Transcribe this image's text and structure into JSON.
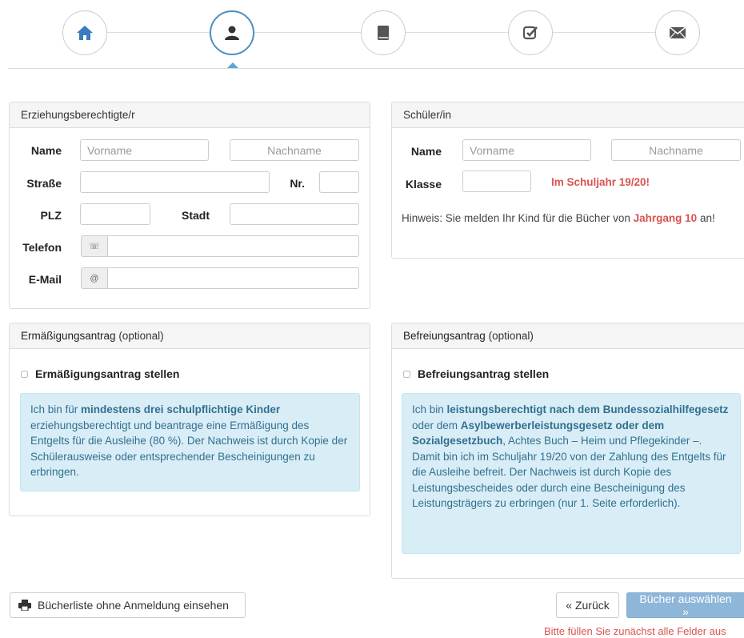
{
  "colors": {
    "accent": "#4a90c2",
    "danger": "#d9534f",
    "info_bg": "#d9edf7",
    "info_text": "#31708f",
    "primary_disabled": "#8eb6d9"
  },
  "wizard": {
    "steps": [
      {
        "icon": "home-icon"
      },
      {
        "icon": "user-icon",
        "active": true
      },
      {
        "icon": "book-icon"
      },
      {
        "icon": "check-square-icon"
      },
      {
        "icon": "envelope-icon"
      }
    ]
  },
  "guardian": {
    "title": "Erziehungsberechtigte/r",
    "name_label": "Name",
    "firstname_placeholder": "Vorname",
    "lastname_placeholder": "Nachname",
    "street_label": "Straße",
    "nr_label": "Nr.",
    "zip_label": "PLZ",
    "city_label": "Stadt",
    "phone_label": "Telefon",
    "phone_addon": "☏",
    "email_label": "E-Mail",
    "email_addon": "@"
  },
  "student": {
    "title": "Schüler/in",
    "name_label": "Name",
    "firstname_placeholder": "Vorname",
    "lastname_placeholder": "Nachname",
    "class_label": "Klasse",
    "year_note": "Im Schuljahr 19/20!",
    "hint_prefix": "Hinweis: Sie melden Ihr Kind für die Bücher von ",
    "hint_grade": "Jahrgang 10",
    "hint_suffix": " an!"
  },
  "reduction": {
    "title": "Ermäßigungsantrag",
    "optional": " (optional)",
    "checkbox_label": "Ermäßigungsantrag stellen",
    "info": {
      "p1": "Ich bin für ",
      "b1": "mindestens drei schulpflichtige Kinder",
      "p2": " erziehungsberechtigt und beantrage eine Ermäßigung des Entgelts für die Ausleihe (80 %). Der Nachweis ist durch Kopie der Schülerausweise oder entsprechender Bescheinigungen zu erbringen."
    }
  },
  "exemption": {
    "title": "Befreiungsantrag",
    "optional": " (optional)",
    "checkbox_label": "Befreiungsantrag stellen",
    "info": {
      "p1": "Ich bin ",
      "b1": "leistungsberechtigt nach dem Bundessozialhilfegesetz",
      "p2": " oder dem ",
      "b2": "Asylbewerberleistungsgesetz oder dem Sozialgesetzbuch",
      "p3": ", Achtes Buch – Heim und Pflegekinder –. Damit bin ich im Schuljahr 19/20 von der Zahlung des Entgelts für die Ausleihe befreit. Der Nachweis ist durch Kopie des Leistungsbescheides oder durch eine Bescheinigung des Leistungsträgers zu erbringen (nur 1. Seite erforderlich)."
    }
  },
  "footer": {
    "booklist_label": "Bücherliste ohne Anmeldung einsehen",
    "back_label": "« Zurück",
    "next_label": "Bücher auswählen »",
    "error": "Bitte füllen Sie zunächst alle Felder aus"
  }
}
